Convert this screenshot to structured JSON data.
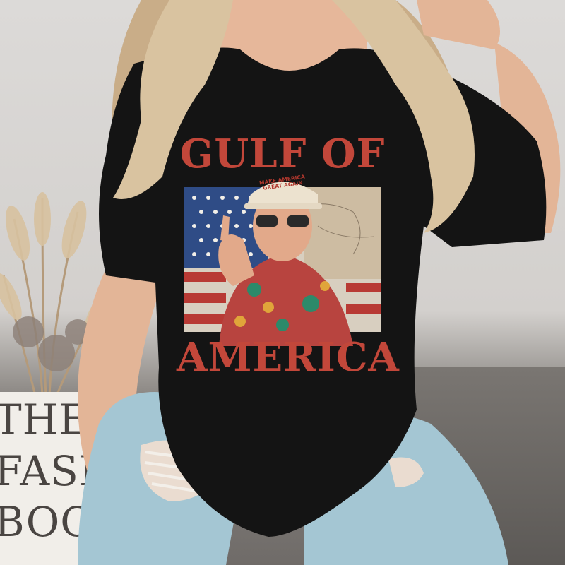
{
  "shirt": {
    "title_top": "GULF OF",
    "title_bottom": "AMERICA",
    "hat_line_1": "MAKE AMERICA",
    "hat_line_2": "GREAT AGAIN"
  },
  "book": {
    "line_1": "THE",
    "line_2": "FASH",
    "line_3": "BOOK"
  },
  "colors": {
    "shirt": "#141414",
    "title_red": "#c2473a",
    "hair": "#d9c3a0",
    "denim": "#9fc3d1",
    "skin": "#e8b99a"
  }
}
